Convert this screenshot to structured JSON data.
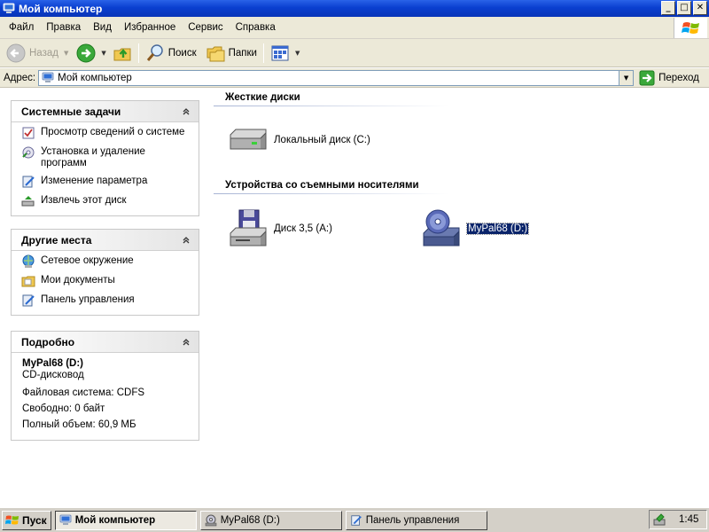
{
  "window": {
    "title": "Мой компьютер",
    "buttons": {
      "minimize": "_",
      "maximize": "□",
      "close": "✕"
    }
  },
  "menu": [
    "Файл",
    "Правка",
    "Вид",
    "Избранное",
    "Сервис",
    "Справка"
  ],
  "toolbar": {
    "back": "Назад",
    "search": "Поиск",
    "folders": "Папки"
  },
  "address": {
    "label": "Адрес:",
    "value": "Мой компьютер",
    "go": "Переход"
  },
  "left_panel": {
    "system_tasks": {
      "title": "Системные задачи",
      "items": [
        "Просмотр сведений о системе",
        "Установка и удаление программ",
        "Изменение параметра",
        "Извлечь этот диск"
      ]
    },
    "other_places": {
      "title": "Другие места",
      "items": [
        "Сетевое окружение",
        "Мои документы",
        "Панель управления"
      ]
    },
    "details": {
      "title": "Подробно",
      "name": "MyPal68 (D:)",
      "type": "CD-дисковод",
      "filesystem": "Файловая система: CDFS",
      "free": "Свободно: 0 байт",
      "total": "Полный объем: 60,9 МБ"
    }
  },
  "main": {
    "hard_drives": {
      "title": "Жесткие диски",
      "items": [
        "Локальный диск (C:)"
      ]
    },
    "removable": {
      "title": "Устройства со съемными носителями",
      "items": [
        "Диск 3,5 (A:)",
        "MyPal68 (D:)"
      ]
    }
  },
  "taskbar": {
    "start": "Пуск",
    "tasks": [
      "Мой компьютер",
      "MyPal68 (D:)",
      "Панель управления"
    ],
    "time": "1:45"
  },
  "colors": {
    "title_bar": "#0a3fd0",
    "selection": "#0a246a",
    "chrome": "#ece9d8"
  }
}
